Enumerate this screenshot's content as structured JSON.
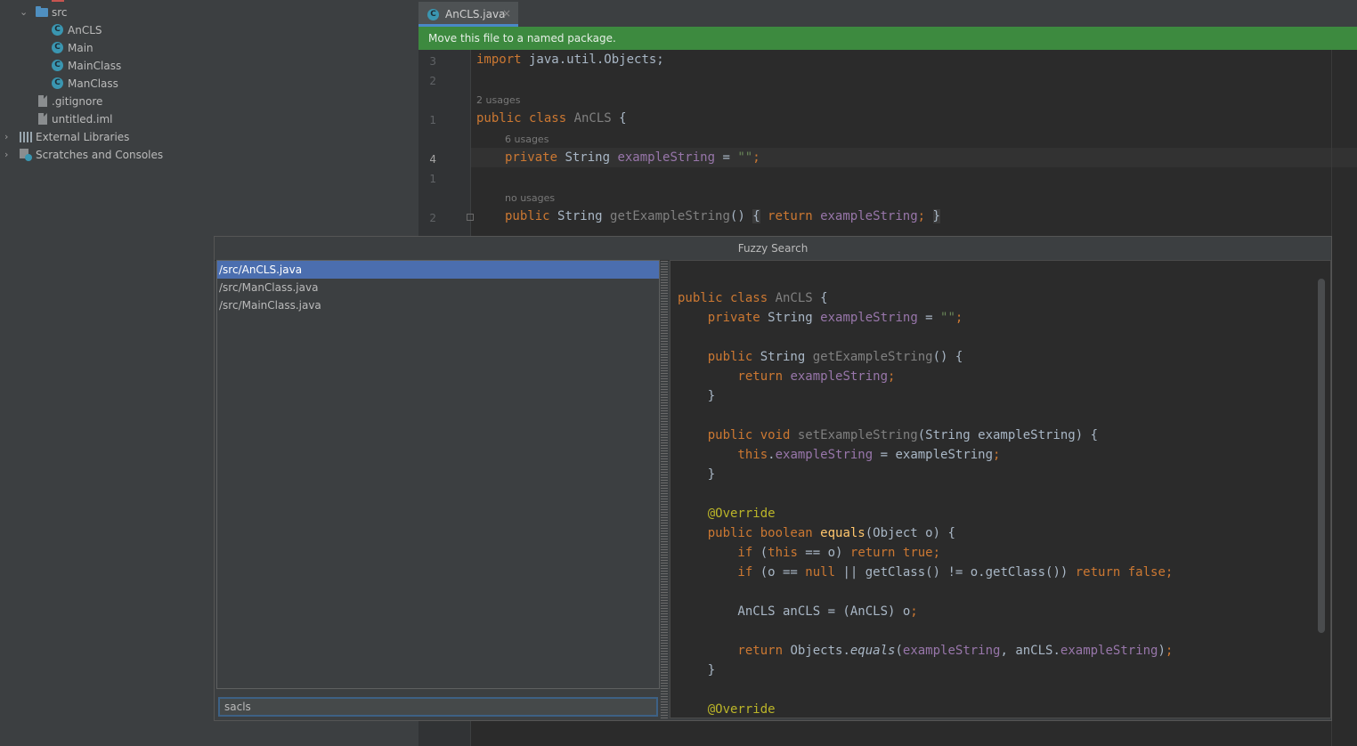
{
  "project_tree": {
    "src_folder": "src",
    "classes": [
      "AnCLS",
      "Main",
      "MainClass",
      "ManClass"
    ],
    "files": [
      ".gitignore",
      "untitled.iml"
    ],
    "external_libraries": "External Libraries",
    "scratches": "Scratches and Consoles"
  },
  "editor": {
    "tab_label": "AnCLS.java",
    "tab_close": "×",
    "banner": "Move this file to a named package.",
    "line_numbers": [
      "3",
      "2",
      "1",
      "4",
      "1",
      "2"
    ],
    "hints": {
      "class_usages": "2 usages",
      "field_usages": "6 usages",
      "method_usages": "no usages"
    },
    "code": {
      "import_kw": "import",
      "import_path": " java.util.Objects;",
      "class_mods": "public class ",
      "class_name": "AnCLS",
      "class_open": " {",
      "field_mod": "private ",
      "field_type": "String ",
      "field_name": "exampleString",
      "field_eq": " = ",
      "field_val": "\"\"",
      "field_end": ";",
      "m_mod": "public ",
      "m_type": "String ",
      "m_name": "getExampleString",
      "m_parens": "() ",
      "m_lbrace": "{",
      "m_ret": " return ",
      "m_field": "exampleString",
      "m_semi": "; ",
      "m_rbrace": "}"
    }
  },
  "fuzzy_search": {
    "title": "Fuzzy Search",
    "results": [
      "/src/AnCLS.java",
      "/src/ManClass.java",
      "/src/MainClass.java"
    ],
    "query": "sacls",
    "preview": {
      "l0": "public class ",
      "l0_name": "AnCLS",
      "l0_end": " {",
      "l1_mod": "    private ",
      "l1_type": "String ",
      "l1_name": "exampleString",
      "l1_eq": " = ",
      "l1_val": "\"\"",
      "l1_end": ";",
      "l3_mod": "    public ",
      "l3_type": "String ",
      "l3_name": "getExampleString",
      "l3_end": "() {",
      "l4_kw": "        return ",
      "l4_fld": "exampleString",
      "l4_end": ";",
      "l5": "    }",
      "l7_mod": "    public void ",
      "l7_name": "setExampleString",
      "l7_end": "(String exampleString) {",
      "l8_kw": "        this",
      "l8_dot": ".",
      "l8_fld": "exampleString",
      "l8_end": " = exampleString",
      "l8_semi": ";",
      "l9": "    }",
      "l11": "    @Override",
      "l12_mod": "    public boolean ",
      "l12_name": "equals",
      "l12_end": "(Object o) {",
      "l13_kw1": "        if ",
      "l13_a": "(",
      "l13_this": "this",
      "l13_b": " == o) ",
      "l13_ret": "return true;",
      "l14_kw1": "        if ",
      "l14_a": "(o == ",
      "l14_null": "null",
      "l14_b": " || getClass() != o.getClass()) ",
      "l14_ret": "return false;",
      "l16": "        AnCLS anCLS = (AnCLS) o",
      "l16_semi": ";",
      "l18_kw": "        return ",
      "l18_a": "Objects.",
      "l18_eq": "equals",
      "l18_b": "(",
      "l18_f1": "exampleString",
      "l18_c": ", anCLS.",
      "l18_f2": "exampleString",
      "l18_d": ")",
      "l18_semi": ";",
      "l19": "    }",
      "l21": "    @Override"
    }
  }
}
